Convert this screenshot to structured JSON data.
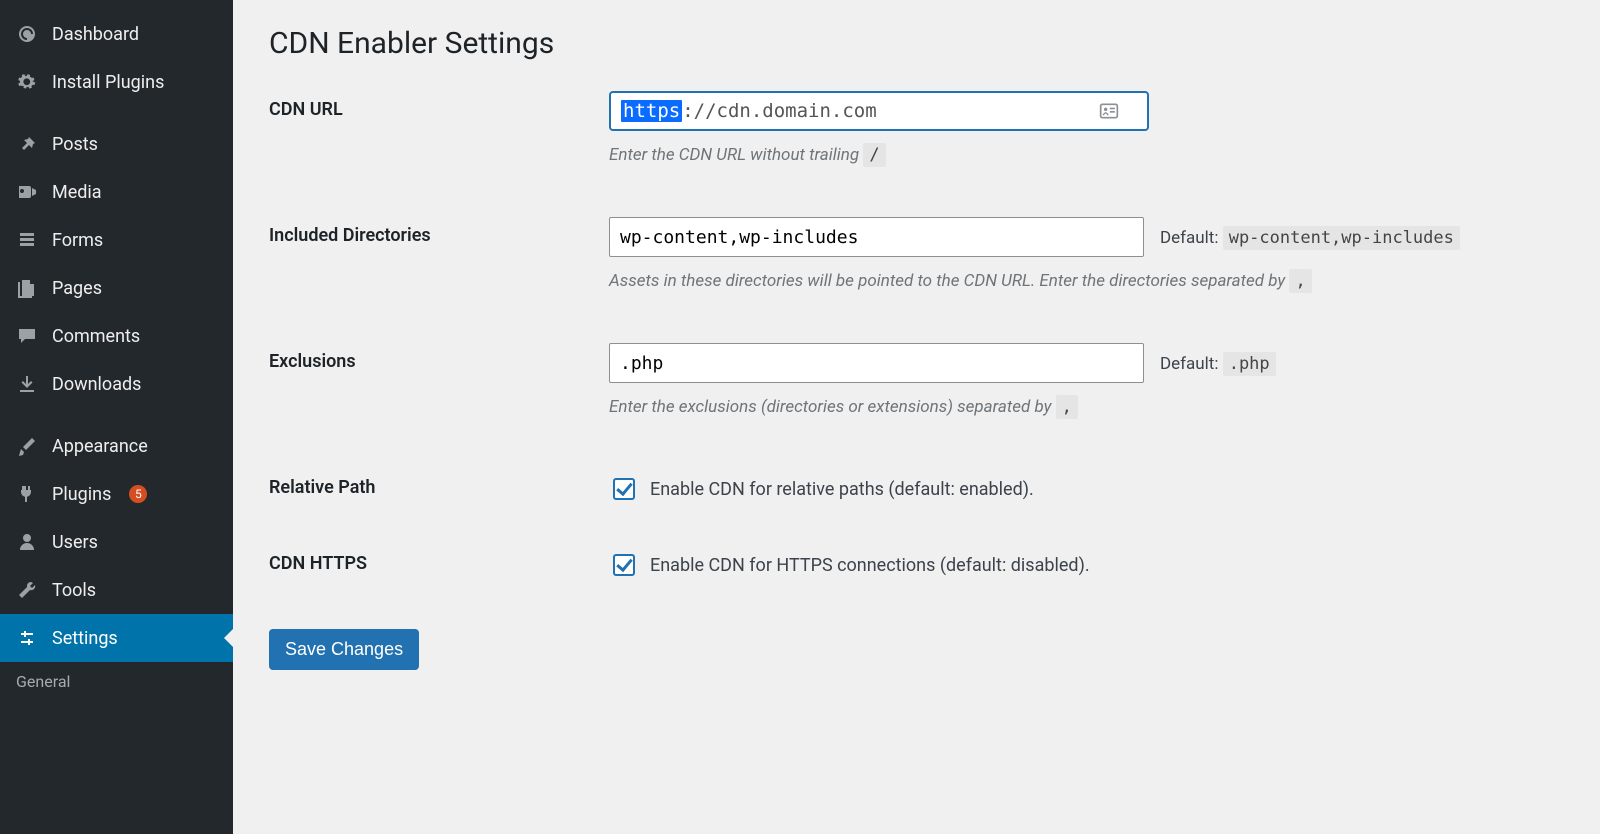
{
  "sidebar": {
    "items": [
      {
        "icon": "dashboard",
        "label": "Dashboard"
      },
      {
        "icon": "plug",
        "label": "Install Plugins"
      },
      {
        "icon": "pin",
        "label": "Posts",
        "gap": true
      },
      {
        "icon": "media",
        "label": "Media"
      },
      {
        "icon": "forms",
        "label": "Forms"
      },
      {
        "icon": "pages",
        "label": "Pages"
      },
      {
        "icon": "comment",
        "label": "Comments"
      },
      {
        "icon": "download",
        "label": "Downloads"
      },
      {
        "icon": "brush",
        "label": "Appearance",
        "gap": true
      },
      {
        "icon": "plug2",
        "label": "Plugins",
        "badge": "5"
      },
      {
        "icon": "user",
        "label": "Users"
      },
      {
        "icon": "wrench",
        "label": "Tools"
      },
      {
        "icon": "settings",
        "label": "Settings",
        "active": true
      }
    ],
    "sub": [
      {
        "label": "General"
      }
    ]
  },
  "page": {
    "title": "CDN Enabler Settings",
    "save_label": "Save Changes"
  },
  "fields": {
    "cdn_url": {
      "label": "CDN URL",
      "selected": "https",
      "rest": "://cdn.domain.com",
      "help_prefix": "Enter the CDN URL without trailing",
      "help_key": "/"
    },
    "included": {
      "label": "Included Directories",
      "value": "wp-content,wp-includes",
      "default_label": "Default:",
      "default_value": "wp-content,wp-includes",
      "help_prefix": "Assets in these directories will be pointed to the CDN URL. Enter the directories separated by",
      "help_key": ","
    },
    "exclusions": {
      "label": "Exclusions",
      "value": ".php",
      "default_label": "Default:",
      "default_value": ".php",
      "help_prefix": "Enter the exclusions (directories or extensions) separated by",
      "help_key": ","
    },
    "relative": {
      "label": "Relative Path",
      "text": "Enable CDN for relative paths (default: enabled).",
      "checked": true
    },
    "https": {
      "label": "CDN HTTPS",
      "text": "Enable CDN for HTTPS connections (default: disabled).",
      "checked": true
    }
  }
}
